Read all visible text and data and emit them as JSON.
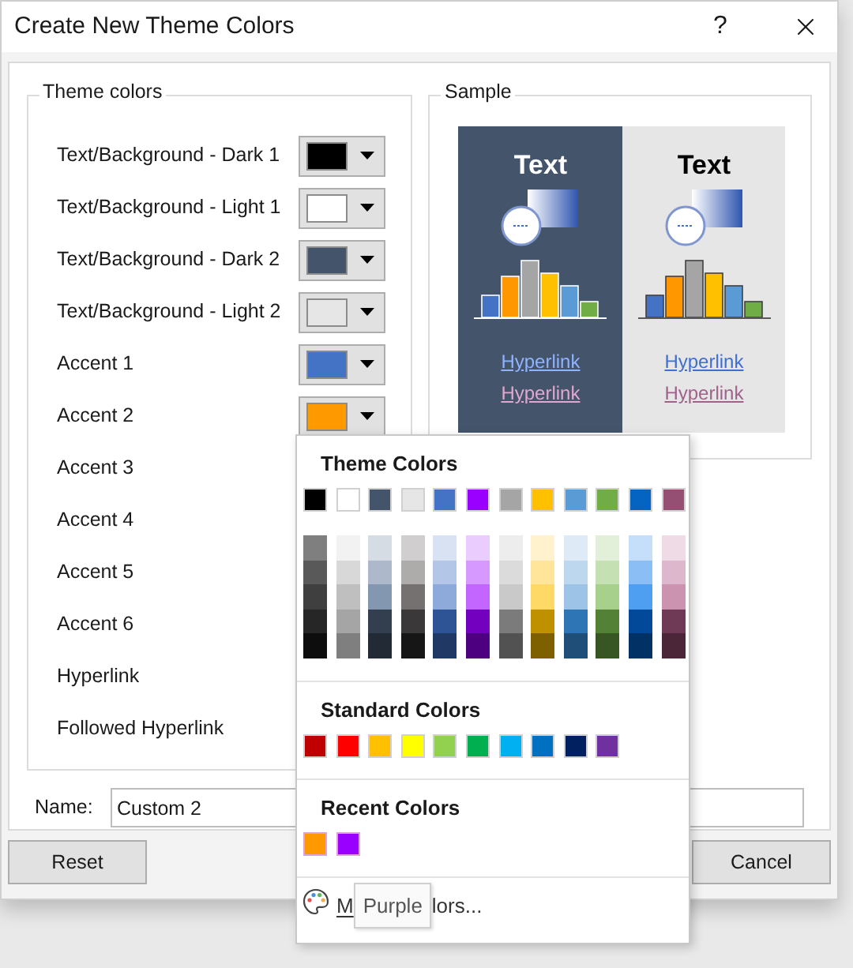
{
  "window": {
    "title": "Create New Theme Colors",
    "help": "?"
  },
  "theme_colors": {
    "legend": "Theme colors",
    "rows": [
      {
        "label": "Text/Background - Dark 1",
        "color": "#000000"
      },
      {
        "label": "Text/Background - Light 1",
        "color": "#ffffff"
      },
      {
        "label": "Text/Background - Dark 2",
        "color": "#44546a"
      },
      {
        "label": "Text/Background - Light 2",
        "color": "#e7e6e6"
      },
      {
        "label": "Accent 1",
        "color": "#4472c4"
      },
      {
        "label": "Accent 2",
        "color": "#ff9900"
      },
      {
        "label": "Accent 3"
      },
      {
        "label": "Accent 4"
      },
      {
        "label": "Accent 5"
      },
      {
        "label": "Accent 6"
      },
      {
        "label": "Hyperlink"
      },
      {
        "label": "Followed Hyperlink"
      }
    ]
  },
  "sample": {
    "legend": "Sample",
    "panels": [
      {
        "kind": "dark",
        "heading": "Text",
        "hyperlink": "Hyperlink",
        "followed_hyperlink": "Hyperlink"
      },
      {
        "kind": "light",
        "heading": "Text",
        "hyperlink": "Hyperlink",
        "followed_hyperlink": "Hyperlink"
      }
    ]
  },
  "name_field": {
    "label": "Name:",
    "value": "Custom 2"
  },
  "buttons": [
    {
      "label": "Reset"
    },
    {
      "label": "Cancel"
    }
  ],
  "color_menu": {
    "sections": [
      {
        "kind": "theme",
        "heading": "Theme Colors",
        "top": [
          {
            "color": "#000000"
          },
          {
            "color": "#ffffff"
          },
          {
            "color": "#44546a"
          },
          {
            "color": "#e7e6e6"
          },
          {
            "color": "#4472c4"
          },
          {
            "color": "#9900ff"
          },
          {
            "color": "#a5a5a5"
          },
          {
            "color": "#ffc000"
          },
          {
            "color": "#5b9bd5"
          },
          {
            "color": "#70ad47"
          },
          {
            "color": "#0563c1"
          },
          {
            "color": "#954f72"
          }
        ],
        "shades": [
          [
            {
              "color": "#7f7f7f"
            },
            {
              "color": "#595959"
            },
            {
              "color": "#3f3f3f"
            },
            {
              "color": "#262626"
            },
            {
              "color": "#0d0d0d"
            }
          ],
          [
            {
              "color": "#f2f2f2"
            },
            {
              "color": "#d8d8d8"
            },
            {
              "color": "#bfbfbf"
            },
            {
              "color": "#a5a5a5"
            },
            {
              "color": "#7f7f7f"
            }
          ],
          [
            {
              "color": "#d6dce4"
            },
            {
              "color": "#adb9ca"
            },
            {
              "color": "#8497b0"
            },
            {
              "color": "#333f4f"
            },
            {
              "color": "#222a35"
            }
          ],
          [
            {
              "color": "#d0cece"
            },
            {
              "color": "#aeabab"
            },
            {
              "color": "#757171"
            },
            {
              "color": "#3a3838"
            },
            {
              "color": "#171616"
            }
          ],
          [
            {
              "color": "#d9e2f3"
            },
            {
              "color": "#b4c6e7"
            },
            {
              "color": "#8eaadb"
            },
            {
              "color": "#2f5496"
            },
            {
              "color": "#1f3864"
            }
          ],
          [
            {
              "color": "#ebccff"
            },
            {
              "color": "#d699ff"
            },
            {
              "color": "#c266ff"
            },
            {
              "color": "#7300bf"
            },
            {
              "color": "#4d0080"
            }
          ],
          [
            {
              "color": "#ededed"
            },
            {
              "color": "#dbdbdb"
            },
            {
              "color": "#c9c9c9"
            },
            {
              "color": "#7b7b7b"
            },
            {
              "color": "#525252"
            }
          ],
          [
            {
              "color": "#fff2cc"
            },
            {
              "color": "#fee599"
            },
            {
              "color": "#ffd965"
            },
            {
              "color": "#bf9000"
            },
            {
              "color": "#7f6000"
            }
          ],
          [
            {
              "color": "#deebf6"
            },
            {
              "color": "#bdd7ee"
            },
            {
              "color": "#9dc3e6"
            },
            {
              "color": "#2e75b5"
            },
            {
              "color": "#1f4e79"
            }
          ],
          [
            {
              "color": "#e2efd9"
            },
            {
              "color": "#c5e0b3"
            },
            {
              "color": "#a8d08d"
            },
            {
              "color": "#538135"
            },
            {
              "color": "#375623"
            }
          ],
          [
            {
              "color": "#c5defa"
            },
            {
              "color": "#8bbef5"
            },
            {
              "color": "#4e9ef2"
            },
            {
              "color": "#03499a"
            },
            {
              "color": "#023166"
            }
          ],
          [
            {
              "color": "#eedbe5"
            },
            {
              "color": "#ddb7cb"
            },
            {
              "color": "#cc93b0"
            },
            {
              "color": "#6f3a55"
            },
            {
              "color": "#4a2638"
            }
          ]
        ]
      },
      {
        "kind": "standard",
        "heading": "Standard Colors",
        "colors": [
          {
            "color": "#c00000"
          },
          {
            "color": "#ff0000"
          },
          {
            "color": "#ffc000"
          },
          {
            "color": "#ffff00"
          },
          {
            "color": "#92d050"
          },
          {
            "color": "#00b050"
          },
          {
            "color": "#00b0f0"
          },
          {
            "color": "#0070c0"
          },
          {
            "color": "#002060"
          },
          {
            "color": "#7030a0"
          }
        ]
      },
      {
        "kind": "recent",
        "heading": "Recent Colors",
        "colors": [
          {
            "color": "#ff9900"
          },
          {
            "color": "#9900ff"
          }
        ]
      }
    ],
    "more_colors": {
      "visible_start": "M",
      "visible_end": "lors..."
    },
    "tooltip": "Purple"
  }
}
